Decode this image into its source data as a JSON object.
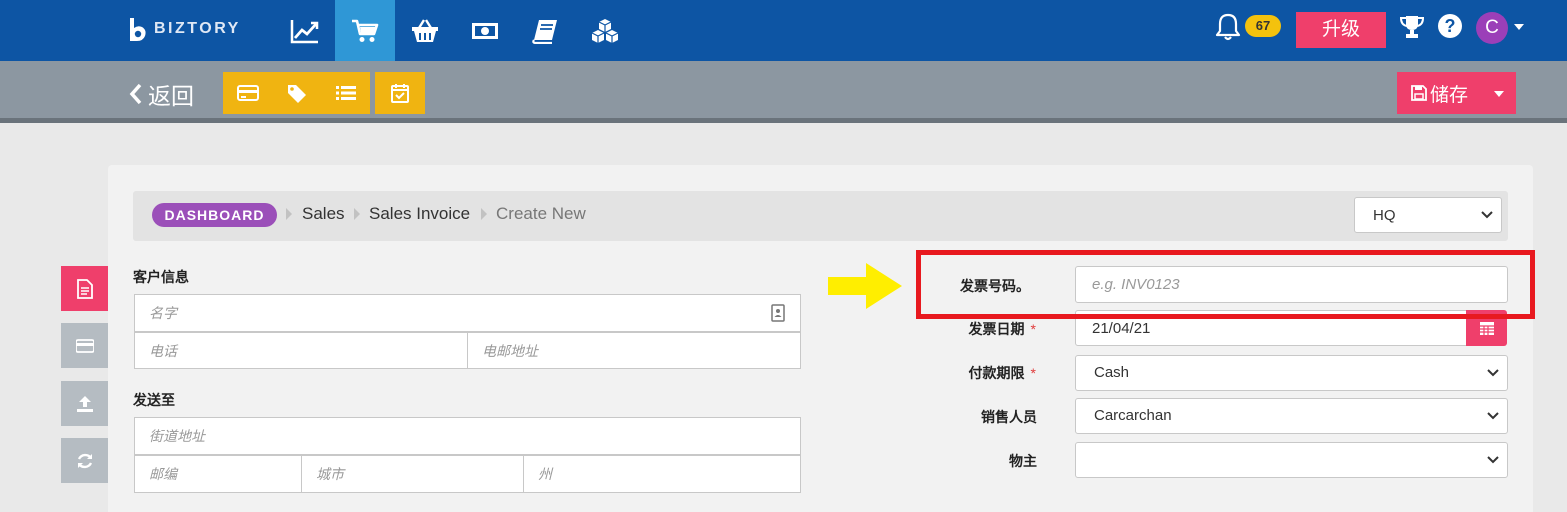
{
  "brand": {
    "name": "BIZTORY"
  },
  "nav": {
    "icons": [
      "chart-line-icon",
      "cart-icon",
      "basket-icon",
      "money-icon",
      "book-icon",
      "cubes-icon"
    ],
    "notifications_count": "67",
    "upgrade_label": "升级",
    "help_label": "?",
    "avatar_initial": "C"
  },
  "toolbar": {
    "back_label": "返回",
    "save_label": "储存",
    "tool_icons": [
      "credit-card-icon",
      "tag-icon",
      "list-icon",
      "calendar-check-icon"
    ]
  },
  "breadcrumb": {
    "dashboard": "DASHBOARD",
    "items": [
      "Sales",
      "Sales Invoice",
      "Create New"
    ]
  },
  "branch_select": {
    "value": "HQ"
  },
  "customer": {
    "section_label": "客户信息",
    "name_placeholder": "名字",
    "phone_placeholder": "电话",
    "email_placeholder": "电邮地址"
  },
  "ship_to": {
    "section_label": "发送至",
    "street_placeholder": "街道地址",
    "postcode_placeholder": "邮编",
    "city_placeholder": "城市",
    "state_placeholder": "州"
  },
  "invoice": {
    "number_label": "发票号码。",
    "number_placeholder": "e.g. INV0123",
    "date_label": "发票日期",
    "date_value": "21/04/21",
    "terms_label": "付款期限",
    "terms_value": "Cash",
    "salesperson_label": "销售人员",
    "salesperson_value": "Carcarchan",
    "owner_label": "物主",
    "owner_value": "",
    "required_mark": "*"
  },
  "colors": {
    "nav_bg": "#0d55a4",
    "nav_active": "#2f97d6",
    "accent_pink": "#ef3f6b",
    "accent_yellow": "#f0b411",
    "dashboard_purple": "#9b4fb9",
    "highlight_red": "#e8191f",
    "arrow_yellow": "#ffee00"
  }
}
